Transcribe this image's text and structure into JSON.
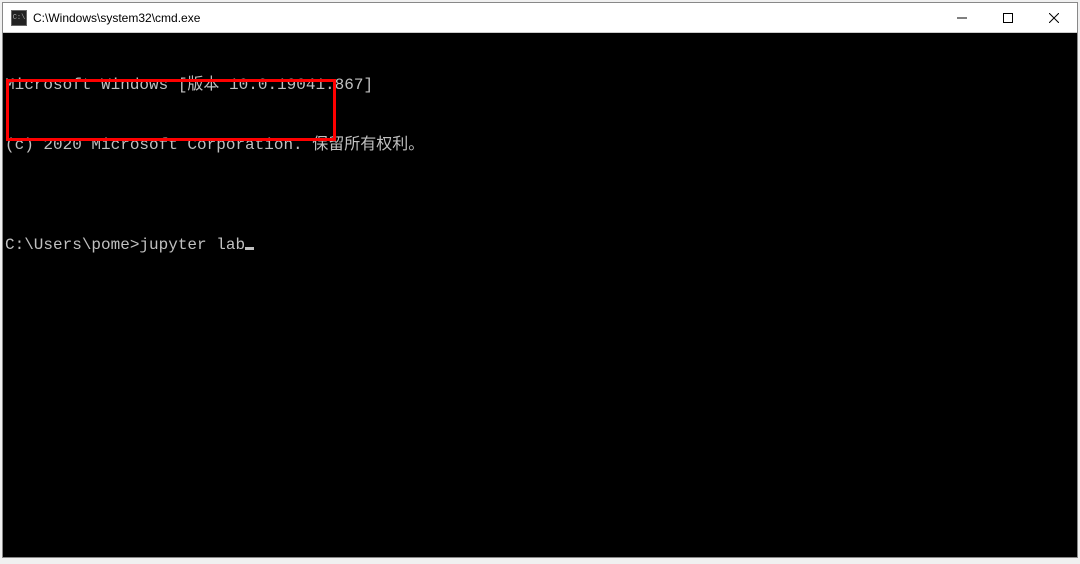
{
  "window": {
    "title": "C:\\Windows\\system32\\cmd.exe",
    "icon_label": "C:\\"
  },
  "controls": {
    "minimize": "Minimize",
    "maximize": "Maximize",
    "close": "Close"
  },
  "terminal": {
    "line1": "Microsoft Windows [版本 10.0.19041.867]",
    "line2": "(c) 2020 Microsoft Corporation. 保留所有权利。",
    "line3_empty": "",
    "prompt": "C:\\Users\\pome>",
    "command": "jupyter lab"
  }
}
